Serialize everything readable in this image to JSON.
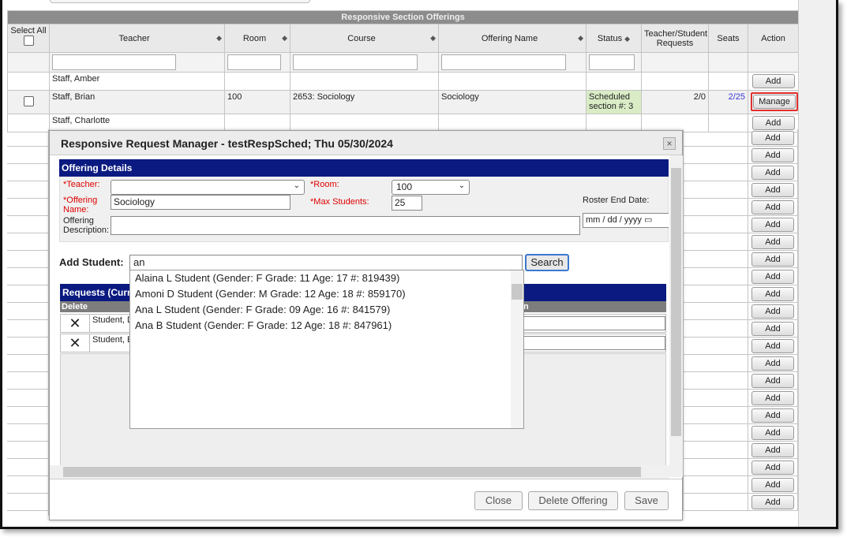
{
  "table": {
    "caption": "Responsive Section Offerings",
    "headers": {
      "select_all": "Select All",
      "teacher": "Teacher",
      "room": "Room",
      "course": "Course",
      "offering_name": "Offering Name",
      "status": "Status",
      "requests": "Teacher/Student Requests",
      "seats": "Seats",
      "action": "Action"
    },
    "rows": [
      {
        "teacher": "Staff, Amber",
        "room": "",
        "course": "",
        "offering": "",
        "status": "",
        "requests": "",
        "seats": "",
        "action": "Add"
      },
      {
        "teacher": "Staff, Brian",
        "room": "100",
        "course": "2653: Sociology",
        "offering": "Sociology",
        "status": "Scheduled section #: 3",
        "requests": "2/0",
        "seats": "2/25",
        "action": "Manage"
      },
      {
        "teacher": "Staff, Charlotte",
        "room": "",
        "course": "",
        "offering": "",
        "status": "",
        "requests": "",
        "seats": "",
        "action": "Add"
      }
    ],
    "add_label": "Add"
  },
  "modal": {
    "title": "Responsive Request Manager - testRespSched; Thu 05/30/2024",
    "close": "×",
    "offering_details": "Offering Details",
    "teacher_label": "*Teacher:",
    "teacher_value": "",
    "room_label": "*Room:",
    "room_value": "100",
    "offering_name_label": "*Offering Name:",
    "offering_name_value": "Sociology",
    "max_students_label": "*Max Students:",
    "max_students_value": "25",
    "roster_end_label": "Roster End Date:",
    "roster_end_placeholder": "mm / dd / yyyy",
    "description_label": "Offering Description:",
    "add_student_label": "Add Student:",
    "search_value": "an",
    "search_button": "Search",
    "requests_header": "Requests (Curr",
    "delete_col": "Delete",
    "col_n": "n",
    "request_rows": [
      "Student, D",
      "Student, E"
    ],
    "suggestions": [
      "Alaina L Student (Gender: F Grade: 11 Age: 17 #: 819439)",
      "Amoni D Student (Gender: M Grade: 12 Age: 18 #: 859170)",
      "Ana L Student (Gender: F Grade: 09 Age: 16 #: 841579)",
      "Ana B Student (Gender: F Grade: 12 Age: 18 #: 847961)"
    ],
    "buttons": {
      "close": "Close",
      "delete": "Delete Offering",
      "save": "Save"
    }
  }
}
